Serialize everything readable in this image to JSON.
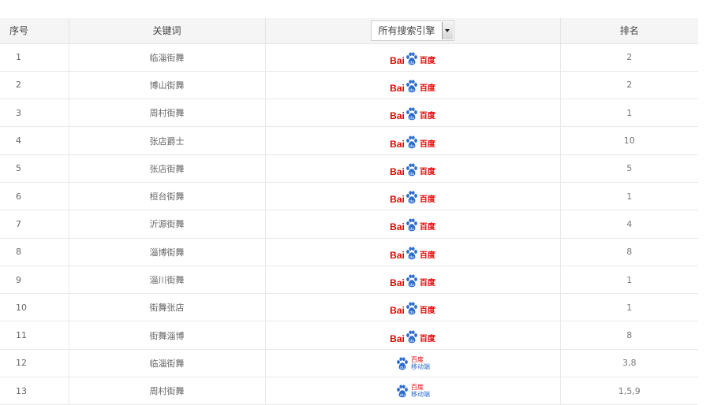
{
  "table": {
    "headers": {
      "index": "序号",
      "keyword": "关键词",
      "engine_select": "所有搜索引擎",
      "rank": "排名"
    },
    "logo_text": {
      "baidu_bai": "Bai",
      "baidu_du": "百度",
      "mobile_top": "百度",
      "mobile_bottom": "移动端"
    },
    "colors": {
      "baidu_red": "#e10602",
      "baidu_blue": "#2b6ccf"
    },
    "rows": [
      {
        "index": "1",
        "keyword": "临淄街舞",
        "engine": "baidu-icon",
        "rank": "2"
      },
      {
        "index": "2",
        "keyword": "博山街舞",
        "engine": "baidu-icon",
        "rank": "2"
      },
      {
        "index": "3",
        "keyword": "周村街舞",
        "engine": "baidu-icon",
        "rank": "1"
      },
      {
        "index": "4",
        "keyword": "张店爵士",
        "engine": "baidu-icon",
        "rank": "10"
      },
      {
        "index": "5",
        "keyword": "张店街舞",
        "engine": "baidu-icon",
        "rank": "5"
      },
      {
        "index": "6",
        "keyword": "桓台街舞",
        "engine": "baidu-icon",
        "rank": "1"
      },
      {
        "index": "7",
        "keyword": "沂源街舞",
        "engine": "baidu-icon",
        "rank": "4"
      },
      {
        "index": "8",
        "keyword": "淄博街舞",
        "engine": "baidu-icon",
        "rank": "8"
      },
      {
        "index": "9",
        "keyword": "淄川街舞",
        "engine": "baidu-icon",
        "rank": "1"
      },
      {
        "index": "10",
        "keyword": "街舞张店",
        "engine": "baidu-icon",
        "rank": "1"
      },
      {
        "index": "11",
        "keyword": "街舞淄博",
        "engine": "baidu-icon",
        "rank": "8"
      },
      {
        "index": "12",
        "keyword": "临淄街舞",
        "engine": "baidu-mobile-icon",
        "rank": "3,8"
      },
      {
        "index": "13",
        "keyword": "周村街舞",
        "engine": "baidu-mobile-icon",
        "rank": "1,5,9"
      }
    ]
  }
}
